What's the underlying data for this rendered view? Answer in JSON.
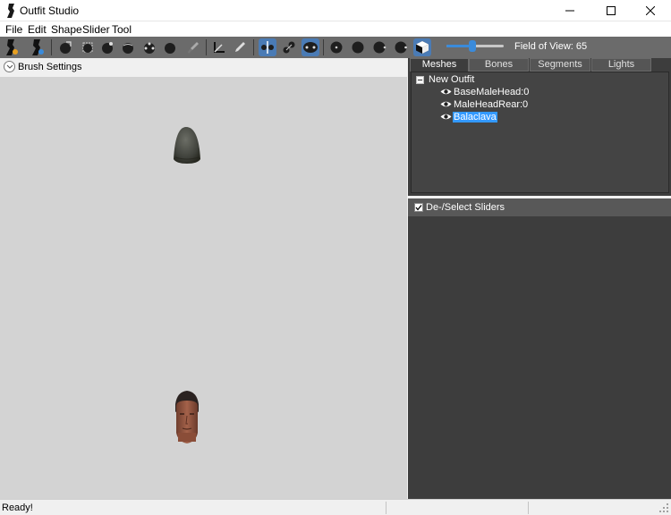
{
  "window": {
    "title": "Outfit Studio"
  },
  "menu": [
    "File",
    "Edit",
    "Shape",
    "Slider",
    "Tool"
  ],
  "toolbar": {
    "fov_label": "Field of View: 65",
    "fov_value": 65,
    "fov_fraction": 0.45
  },
  "brush": {
    "label": "Brush Settings"
  },
  "tabs": [
    "Meshes",
    "Bones",
    "Segments",
    "Lights"
  ],
  "active_tab": "Meshes",
  "tree": {
    "root": "New Outfit",
    "items": [
      "BaseMaleHead:0",
      "MaleHeadRear:0",
      "Balaclava"
    ],
    "selected": "Balaclava"
  },
  "sliders": {
    "label": "De-/Select Sliders",
    "checked": true
  },
  "status": {
    "text": "Ready!"
  },
  "colors": {
    "toolbar_bg": "#6b6b6b",
    "panel_bg": "#3d3d3d",
    "viewport_bg": "#d3d3d3",
    "accent": "#3399ff"
  }
}
